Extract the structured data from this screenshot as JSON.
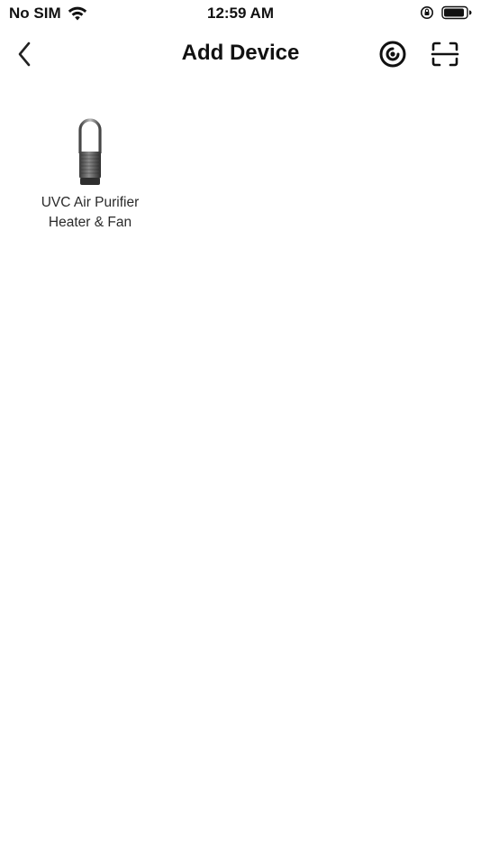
{
  "status_bar": {
    "carrier": "No SIM",
    "time": "12:59 AM",
    "icons": [
      "wifi-icon",
      "orientation-lock-icon",
      "battery-icon"
    ]
  },
  "nav": {
    "title": "Add Device",
    "back_icon": "chevron-left-icon",
    "actions": [
      "nearby-scan-icon",
      "qr-scan-icon"
    ]
  },
  "devices": [
    {
      "name_line1": "UVC Air Purifier",
      "name_line2": "Heater & Fan",
      "icon": "air-purifier-tower-icon"
    }
  ]
}
